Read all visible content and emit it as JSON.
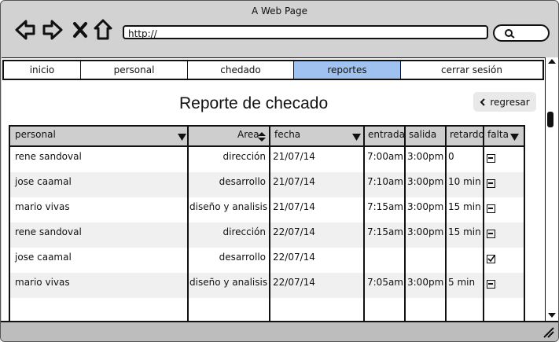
{
  "window": {
    "title": "A Web Page"
  },
  "browser": {
    "url": "http://"
  },
  "tabs": [
    {
      "label": "inicio",
      "active": false
    },
    {
      "label": "personal",
      "active": false
    },
    {
      "label": "chedado",
      "active": false
    },
    {
      "label": "reportes",
      "active": true
    },
    {
      "label": "cerrar sesión",
      "active": false
    }
  ],
  "page": {
    "title": "Reporte de checado",
    "back_label": "regresar"
  },
  "table": {
    "headers": [
      "personal",
      "Area",
      "fecha",
      "entrada",
      "salida",
      "retardo",
      "falta"
    ],
    "rows": [
      {
        "personal": "rene sandoval",
        "area": "dirección",
        "fecha": "21/07/14",
        "entrada": "7:00am",
        "salida": "3:00pm",
        "retardo": "0",
        "falta": "unchecked"
      },
      {
        "personal": "jose caamal",
        "area": "desarrollo",
        "fecha": "21/07/14",
        "entrada": "7:10am",
        "salida": "3:00pm",
        "retardo": "10 min",
        "falta": "unchecked"
      },
      {
        "personal": "mario vivas",
        "area": "diseño y analisis",
        "fecha": "21/07/14",
        "entrada": "7:15am",
        "salida": "3:00pm",
        "retardo": "15 min",
        "falta": "unchecked"
      },
      {
        "personal": "rene sandoval",
        "area": "dirección",
        "fecha": "22/07/14",
        "entrada": "7:15am",
        "salida": "3:00pm",
        "retardo": "15 min",
        "falta": "unchecked"
      },
      {
        "personal": "jose caamal",
        "area": "desarrollo",
        "fecha": "22/07/14",
        "entrada": "",
        "salida": "",
        "retardo": "",
        "falta": "checked"
      },
      {
        "personal": "mario vivas",
        "area": "diseño y analisis",
        "fecha": "22/07/14",
        "entrada": "7:05am",
        "salida": "3:00pm",
        "retardo": "5 min",
        "falta": "unchecked"
      }
    ]
  }
}
